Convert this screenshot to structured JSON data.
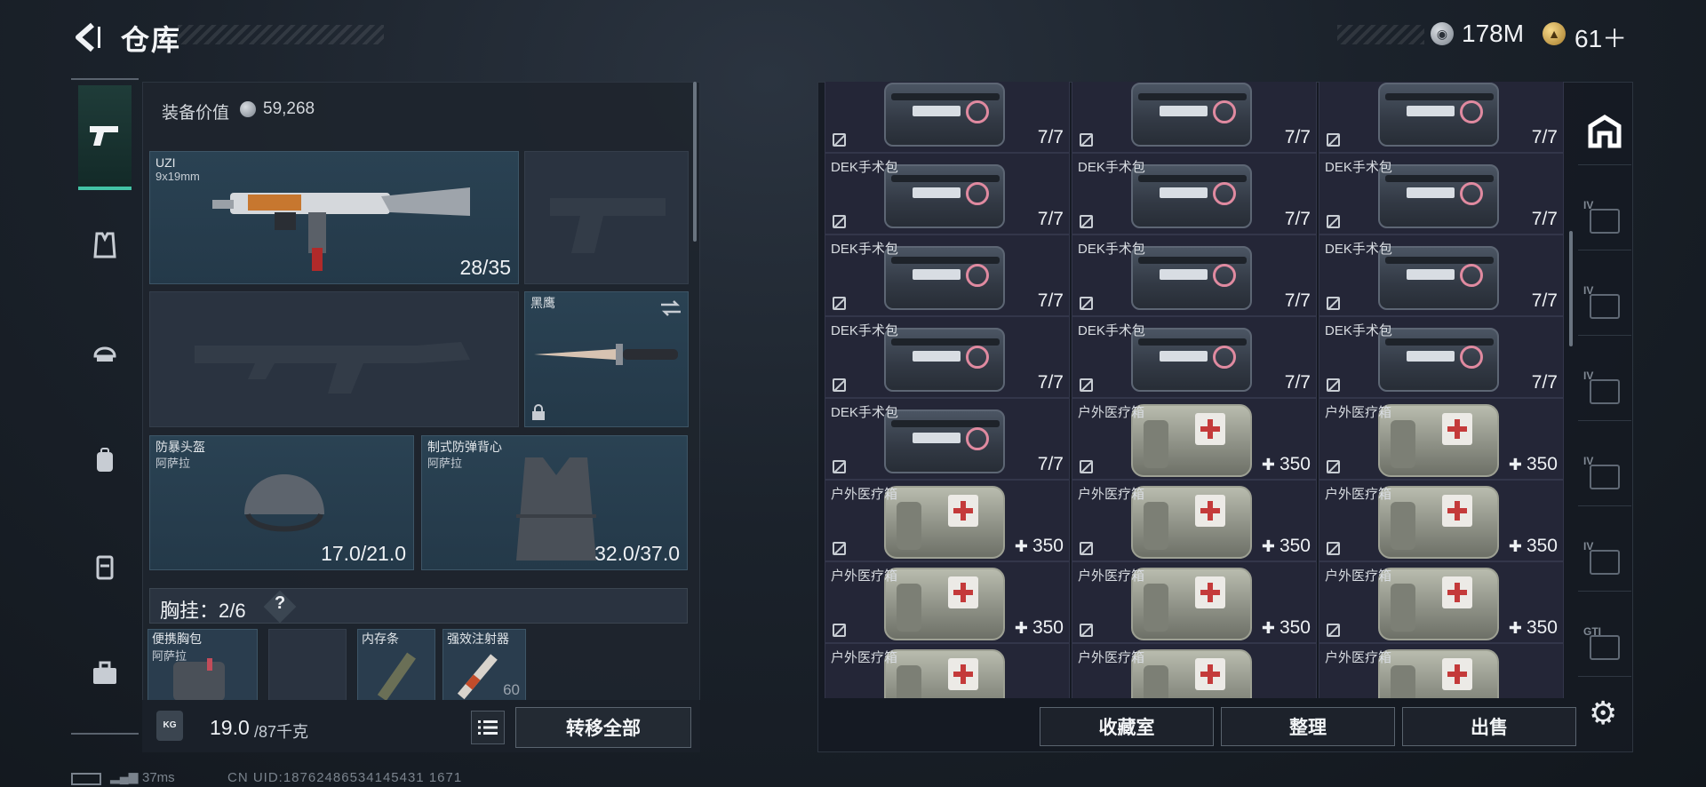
{
  "header": {
    "title": "仓库",
    "silver_amount": "178M",
    "gold_amount": "61＋",
    "silver_icon": "silver-coin-icon",
    "gold_icon": "gold-coin-icon"
  },
  "left_nav": [
    {
      "name": "weapons",
      "icon": "pistol-icon",
      "active": true
    },
    {
      "name": "armor-vest",
      "icon": "vest-icon",
      "active": false
    },
    {
      "name": "helmet",
      "icon": "helmet-icon",
      "active": false
    },
    {
      "name": "backpack",
      "icon": "backpack-icon",
      "active": false
    },
    {
      "name": "chest-rig",
      "icon": "rig-icon",
      "active": false
    },
    {
      "name": "case",
      "icon": "briefcase-icon",
      "active": false
    }
  ],
  "loadout": {
    "equip_value_label": "装备价值",
    "equip_value": "59,268",
    "primary": {
      "name": "UZI",
      "caliber": "9x19mm",
      "ammo": "28/35"
    },
    "melee": {
      "name": "黑鹰"
    },
    "helmet": {
      "name": "防暴头盔",
      "sub": "阿萨拉",
      "durability": "17.0/21.0"
    },
    "vest": {
      "name": "制式防弹背心",
      "sub": "阿萨拉",
      "durability": "32.0/37.0"
    },
    "chest_rig": {
      "label": "胸挂：2/6",
      "help": "?"
    },
    "chest_slots": [
      {
        "name": "便携胸包",
        "sub": "阿萨拉",
        "count": ""
      },
      {
        "name": "",
        "sub": "",
        "count": ""
      },
      {
        "name": "内存条",
        "sub": "",
        "count": ""
      },
      {
        "name": "强效注射器",
        "sub": "",
        "count": "60"
      }
    ],
    "weight_value": "19.0",
    "weight_max": "/87千克",
    "weight_icon_text": "KG",
    "transfer_all": "转移全部"
  },
  "inventory": {
    "items": [
      {
        "label": "",
        "count": "7/7",
        "kind": "kit"
      },
      {
        "label": "",
        "count": "7/7",
        "kind": "kit"
      },
      {
        "label": "",
        "count": "7/7",
        "kind": "kit"
      },
      {
        "label": "DEK手术包",
        "count": "7/7",
        "kind": "kit"
      },
      {
        "label": "DEK手术包",
        "count": "7/7",
        "kind": "kit"
      },
      {
        "label": "DEK手术包",
        "count": "7/7",
        "kind": "kit"
      },
      {
        "label": "DEK手术包",
        "count": "7/7",
        "kind": "kit"
      },
      {
        "label": "DEK手术包",
        "count": "7/7",
        "kind": "kit"
      },
      {
        "label": "DEK手术包",
        "count": "7/7",
        "kind": "kit"
      },
      {
        "label": "DEK手术包",
        "count": "7/7",
        "kind": "kit"
      },
      {
        "label": "DEK手术包",
        "count": "7/7",
        "kind": "kit"
      },
      {
        "label": "DEK手术包",
        "count": "7/7",
        "kind": "kit"
      },
      {
        "label": "DEK手术包",
        "count": "7/7",
        "kind": "kit"
      },
      {
        "label": "户外医疗箱",
        "count": "350",
        "kind": "med"
      },
      {
        "label": "户外医疗箱",
        "count": "350",
        "kind": "med"
      },
      {
        "label": "户外医疗箱",
        "count": "350",
        "kind": "med"
      },
      {
        "label": "户外医疗箱",
        "count": "350",
        "kind": "med"
      },
      {
        "label": "户外医疗箱",
        "count": "350",
        "kind": "med"
      },
      {
        "label": "户外医疗箱",
        "count": "350",
        "kind": "med"
      },
      {
        "label": "户外医疗箱",
        "count": "350",
        "kind": "med"
      },
      {
        "label": "户外医疗箱",
        "count": "350",
        "kind": "med"
      },
      {
        "label": "户外医疗箱",
        "count": "350",
        "kind": "med"
      },
      {
        "label": "户外医疗箱",
        "count": "350",
        "kind": "med"
      },
      {
        "label": "户外医疗箱",
        "count": "350",
        "kind": "med"
      },
      {
        "label": "户外医疗箱",
        "count": "",
        "kind": "med"
      },
      {
        "label": "户外医疗箱",
        "count": "",
        "kind": "med"
      },
      {
        "label": "户外医疗箱",
        "count": "",
        "kind": "med"
      }
    ],
    "buttons": {
      "collection": "收藏室",
      "sort": "整理",
      "sell": "出售"
    }
  },
  "right_tabs": [
    {
      "tag": "",
      "icon": "home-storage-icon"
    },
    {
      "tag": "IV",
      "icon": "container-icon"
    },
    {
      "tag": "IV",
      "icon": "container-add-icon"
    },
    {
      "tag": "IV",
      "icon": "container-weapon-icon"
    },
    {
      "tag": "IV",
      "icon": "container-tools-icon"
    },
    {
      "tag": "IV",
      "icon": "container-gear-icon"
    },
    {
      "tag": "GTI",
      "icon": "container-misc-icon"
    }
  ],
  "status": {
    "latency": "37ms",
    "uid": "CN UID:18762486534145431 1671"
  }
}
